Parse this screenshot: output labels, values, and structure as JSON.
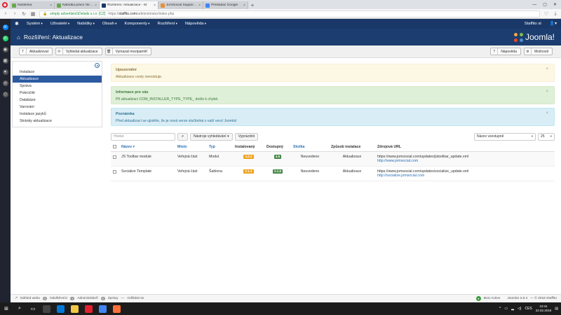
{
  "browser": {
    "tabs": [
      {
        "label": "Nástěnka",
        "color": "#6aa84f"
      },
      {
        "label": "Nabídka práce čtená 2 hodin",
        "color": "#6aa84f"
      },
      {
        "label": "Rozšíření: Aktualizace - St",
        "color": "#1a3867",
        "active": true
      },
      {
        "label": "JomSocial Support Forum",
        "color": "#e69138"
      },
      {
        "label": "Překladač Google",
        "color": "#4285f4"
      }
    ],
    "new_tab": "+",
    "url": {
      "cert": "simply advertisinGDetails s.r.o. [CZ]",
      "host_prefix": "https://",
      "host": "staffito.com",
      "path": "/administrator/index.php"
    }
  },
  "joomla_nav": {
    "items": [
      "Systém",
      "Uživatelé",
      "Nabídky",
      "Obsah",
      "Komponenty",
      "Rozšíření",
      "Nápověda"
    ],
    "user": "Staffito st",
    "user_icon": "user-icon"
  },
  "header": {
    "title": "Rozšíření: Aktualizace",
    "brand": "Joomla!"
  },
  "toolbar": {
    "update": "Aktualizovat",
    "find_updates": "Vyhledat aktualizace",
    "clear_cache": "Vymazat mezipaměť",
    "help": "Nápověda",
    "options": "Možnosti"
  },
  "submenu": {
    "items": [
      "Instalace",
      "Aktualizace",
      "Správa",
      "Pokročilé",
      "Databáze",
      "Varování",
      "Instalace jazyků",
      "Stránky aktualizace"
    ],
    "active_index": 1
  },
  "alerts": {
    "warning": {
      "heading": "Upozornění",
      "text": "Aktualizace cesty neexistuje."
    },
    "info": {
      "heading": "Informace pro vás",
      "text": "Při aktualizaci COM_INSTALLER_TYPE_TYPE_ došlo k chybě."
    },
    "note": {
      "heading": "Poznámka",
      "text": "Před aktualizací se ujistěte, že je nová verze slučitelná s vaší verzí Joomla!"
    }
  },
  "filters": {
    "search_placeholder": "Hledat",
    "search_tools": "Nástroje vyhledávání ▾",
    "clear": "Vyprázdnit",
    "sort": "Název vzestupně",
    "limit": "25"
  },
  "table": {
    "headers": [
      "Název ▾",
      "Místo",
      "Typ",
      "Instalovaný",
      "Dostupný",
      "Složka",
      "Způsob instalace",
      "Zdrojová URL"
    ],
    "rows": [
      {
        "name": "JS Toolbar module",
        "location": "Veřejná část",
        "type": "Modul",
        "installed": "4.3.4",
        "available": "4.5",
        "folder": "Neuvedeno",
        "method": "Aktualizace",
        "url": "https://www.jomsocial.com/updates/jstoolbar_update.xml",
        "url2": "http://www.jomsocial.com"
      },
      {
        "name": "Socialize Template",
        "location": "Veřejná část",
        "type": "Šablona",
        "installed": "2.1.4",
        "available": "2.1.6",
        "folder": "Neuvedeno",
        "method": "Aktualizace",
        "url": "https://www.jomsocial.com/updates/socialize_update.xml",
        "url2": "http://socialize.jomsocial.com"
      }
    ]
  },
  "statusbar": {
    "view_site": "Náhled webu",
    "visitors_count": "0",
    "visitors": "Návštěvníci",
    "admins_count": "1",
    "admins": "Administrátoři",
    "messages_count": "0",
    "messages": "Zprávy",
    "logout": "Odhlásit se",
    "bou": "BoU Active",
    "version": "Joomla! 3.8.4",
    "copyright": "— © 2018 Staffito"
  },
  "taskbar": {
    "lang": "CES",
    "time": "10:41",
    "date": "22.02.2018"
  }
}
